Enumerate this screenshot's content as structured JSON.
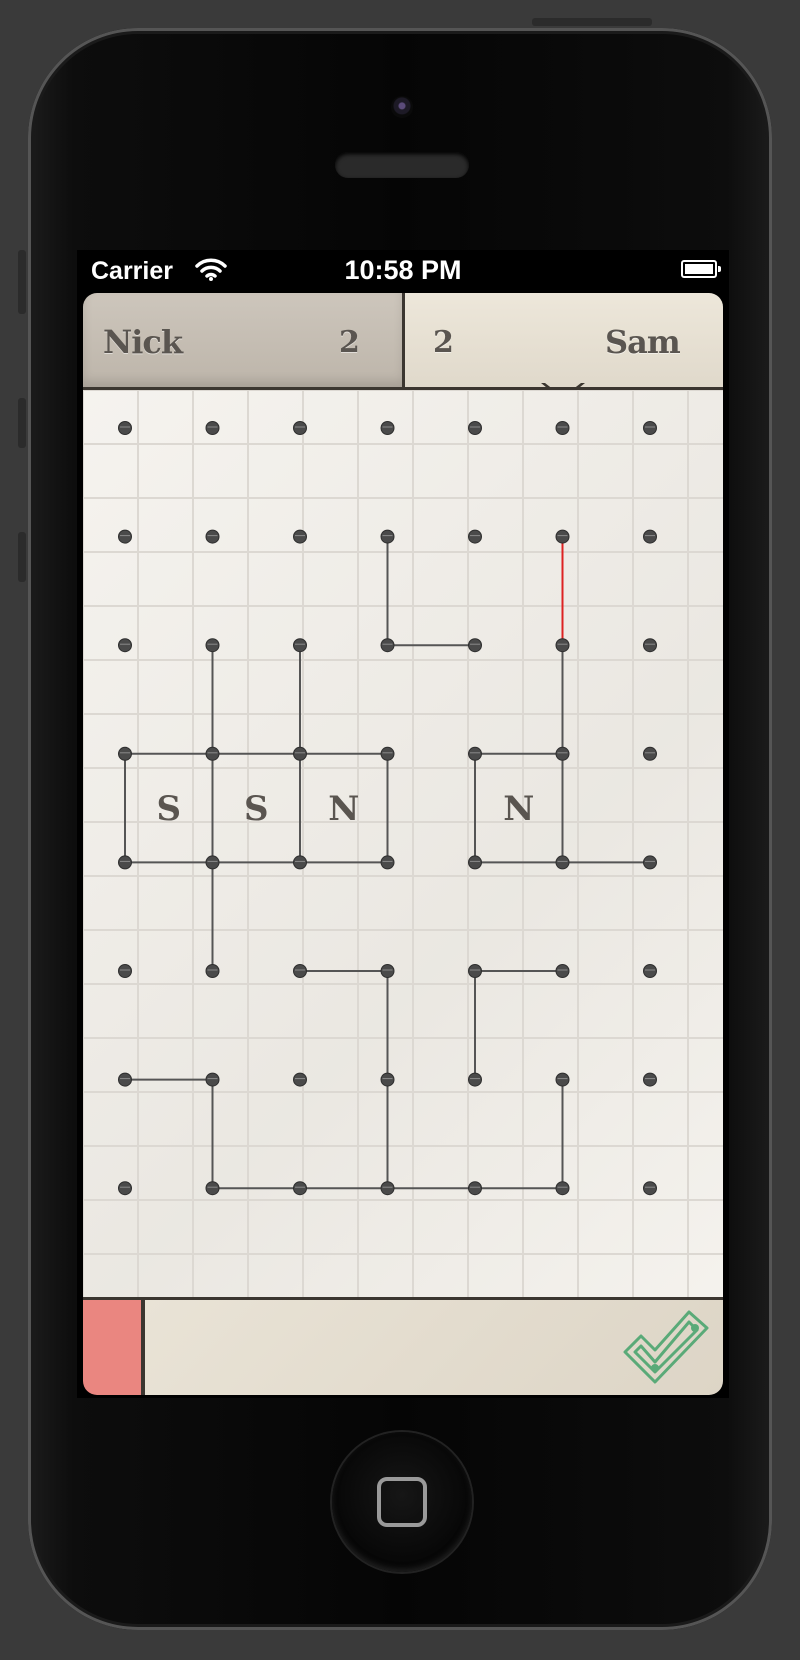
{
  "status_bar": {
    "carrier": "Carrier",
    "time": "10:58 PM",
    "wifi_icon": "wifi-icon",
    "battery_icon": "battery-icon"
  },
  "players": {
    "left": {
      "name": "Nick",
      "score": "2"
    },
    "right": {
      "name": "Sam",
      "score": "2"
    },
    "active_turn": "right"
  },
  "board": {
    "dot_columns": 7,
    "dot_rows": 8,
    "edges": [
      {
        "from": [
          3,
          1
        ],
        "to": [
          3,
          2
        ],
        "color": "#555"
      },
      {
        "from": [
          3,
          2
        ],
        "to": [
          4,
          2
        ],
        "color": "#555"
      },
      {
        "from": [
          5,
          1
        ],
        "to": [
          5,
          2
        ],
        "color": "#d22"
      },
      {
        "from": [
          5,
          2
        ],
        "to": [
          5,
          3
        ],
        "color": "#555"
      },
      {
        "from": [
          5,
          3
        ],
        "to": [
          5,
          4
        ],
        "color": "#555"
      },
      {
        "from": [
          1,
          2
        ],
        "to": [
          1,
          3
        ],
        "color": "#555"
      },
      {
        "from": [
          2,
          2
        ],
        "to": [
          2,
          3
        ],
        "color": "#555"
      },
      {
        "from": [
          0,
          3
        ],
        "to": [
          1,
          3
        ],
        "color": "#555"
      },
      {
        "from": [
          1,
          3
        ],
        "to": [
          2,
          3
        ],
        "color": "#555"
      },
      {
        "from": [
          2,
          3
        ],
        "to": [
          3,
          3
        ],
        "color": "#555"
      },
      {
        "from": [
          0,
          3
        ],
        "to": [
          0,
          4
        ],
        "color": "#555"
      },
      {
        "from": [
          1,
          3
        ],
        "to": [
          1,
          4
        ],
        "color": "#555"
      },
      {
        "from": [
          2,
          3
        ],
        "to": [
          2,
          4
        ],
        "color": "#555"
      },
      {
        "from": [
          3,
          3
        ],
        "to": [
          3,
          4
        ],
        "color": "#555"
      },
      {
        "from": [
          0,
          4
        ],
        "to": [
          1,
          4
        ],
        "color": "#555"
      },
      {
        "from": [
          1,
          4
        ],
        "to": [
          2,
          4
        ],
        "color": "#555"
      },
      {
        "from": [
          2,
          4
        ],
        "to": [
          3,
          4
        ],
        "color": "#555"
      },
      {
        "from": [
          4,
          3
        ],
        "to": [
          5,
          3
        ],
        "color": "#555"
      },
      {
        "from": [
          4,
          3
        ],
        "to": [
          4,
          4
        ],
        "color": "#555"
      },
      {
        "from": [
          4,
          4
        ],
        "to": [
          5,
          4
        ],
        "color": "#555"
      },
      {
        "from": [
          5,
          4
        ],
        "to": [
          6,
          4
        ],
        "color": "#555"
      },
      {
        "from": [
          1,
          4
        ],
        "to": [
          1,
          5
        ],
        "color": "#555"
      },
      {
        "from": [
          2,
          5
        ],
        "to": [
          3,
          5
        ],
        "color": "#555"
      },
      {
        "from": [
          3,
          5
        ],
        "to": [
          3,
          6
        ],
        "color": "#555"
      },
      {
        "from": [
          3,
          6
        ],
        "to": [
          3,
          7
        ],
        "color": "#555"
      },
      {
        "from": [
          4,
          5
        ],
        "to": [
          5,
          5
        ],
        "color": "#555"
      },
      {
        "from": [
          4,
          5
        ],
        "to": [
          4,
          6
        ],
        "color": "#555"
      },
      {
        "from": [
          5,
          6
        ],
        "to": [
          5,
          7
        ],
        "color": "#555"
      },
      {
        "from": [
          0,
          6
        ],
        "to": [
          1,
          6
        ],
        "color": "#555"
      },
      {
        "from": [
          1,
          6
        ],
        "to": [
          1,
          7
        ],
        "color": "#555"
      },
      {
        "from": [
          1,
          7
        ],
        "to": [
          2,
          7
        ],
        "color": "#555"
      },
      {
        "from": [
          2,
          7
        ],
        "to": [
          3,
          7
        ],
        "color": "#555"
      },
      {
        "from": [
          3,
          7
        ],
        "to": [
          4,
          7
        ],
        "color": "#555"
      },
      {
        "from": [
          4,
          7
        ],
        "to": [
          5,
          7
        ],
        "color": "#555"
      }
    ],
    "boxes": [
      {
        "cell": [
          0,
          3
        ],
        "owner": "S"
      },
      {
        "cell": [
          1,
          3
        ],
        "owner": "S"
      },
      {
        "cell": [
          2,
          3
        ],
        "owner": "N"
      },
      {
        "cell": [
          4,
          3
        ],
        "owner": "N"
      }
    ]
  },
  "controls": {
    "player_color": "#ea8680",
    "submit_icon": "checkmark-icon",
    "submit_color": "#5aaa78"
  }
}
